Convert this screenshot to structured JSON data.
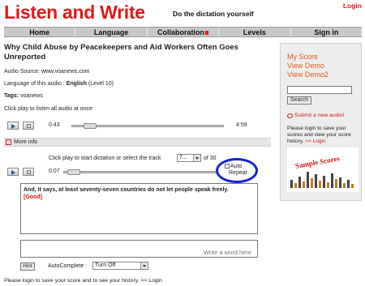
{
  "header": {
    "logo": "Listen and Write",
    "tagline": "Do the dictation yourself",
    "login": "Login"
  },
  "nav": [
    "Home",
    "Language",
    "Collaboration",
    "Levels",
    "Sign in"
  ],
  "article": {
    "title": "Why Child Abuse by Peacekeepers and Aid Workers Often Goes Unreported",
    "source_label": "Audio Source:",
    "source_value": "www.voanews.com",
    "language_label": "Language of this audio :",
    "language_value": "English",
    "level_text": "(Level 10)",
    "tags_label": "Tags:",
    "tags_value": "voanews",
    "play_all_text": "Click play to listen all audio at once"
  },
  "player_all": {
    "current_time": "0:43",
    "total_time": "4:59",
    "progress": 0.09
  },
  "more_info": "More info",
  "track": {
    "prompt": "Click play to start dictation or select the track",
    "selected": "7...",
    "of_text": "of 30",
    "current_time": "0:07",
    "progress": 0.03,
    "auto_repeat_line1": "Auto",
    "auto_repeat_line2": "Repeat"
  },
  "dictation": {
    "text": "And, it says, at least seventy-seven countries do not let people speak freely.",
    "status": "[Good]"
  },
  "write": {
    "placeholder": "Write a word here"
  },
  "controls": {
    "hint": "Hint",
    "autocomplete_label": "AutoComplete :",
    "autocomplete_value": "Turn Off"
  },
  "footer": "Please login to save your score and to see your history. >> Login",
  "sidebar": {
    "my_score": "My Score",
    "view_demo": "View Demo",
    "view_demo2": "View Demo2",
    "search_button": "Search",
    "submit_audio": "Submit a new audio!",
    "note": "Please login to save your scores and view your score history.",
    "note_link": ">> Login",
    "sample_label": "Sample Scores"
  },
  "colors": {
    "brand_red": "#e01a1a",
    "circle_blue": "#1a22d8",
    "link_orange": "#e05a1a"
  }
}
